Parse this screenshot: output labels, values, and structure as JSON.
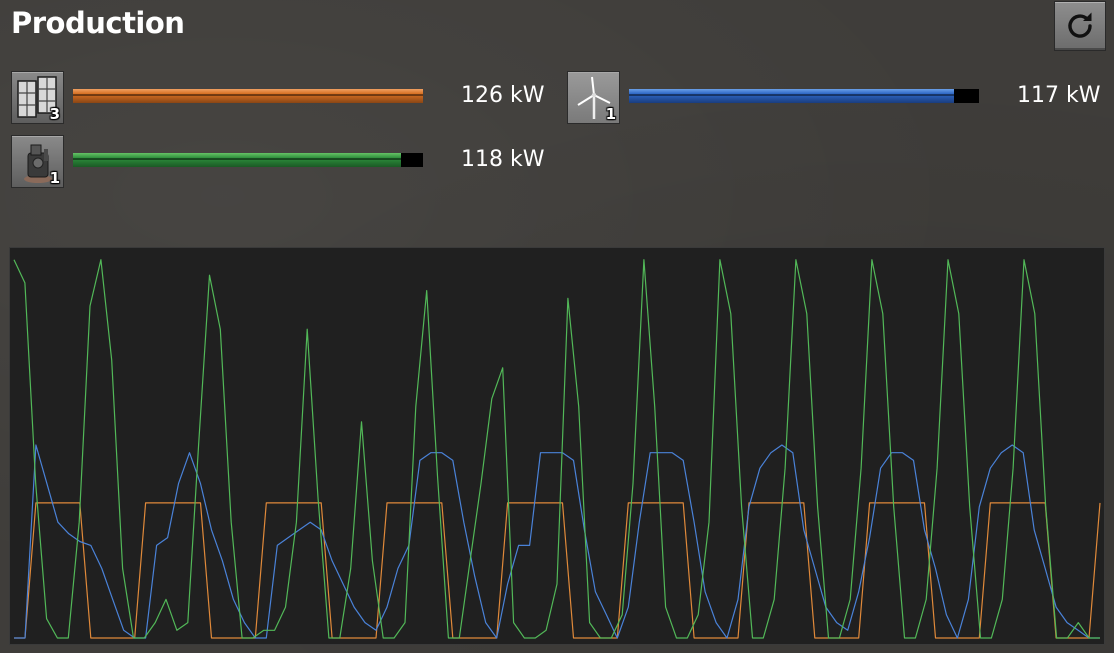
{
  "header": {
    "title": "Production"
  },
  "entries": [
    {
      "name": "solar-panel",
      "icon": "solar-panel-icon",
      "count": "3",
      "value_label": "126 kW",
      "fill": 1.0,
      "color": "#d66f22"
    },
    {
      "name": "wind-turbine",
      "icon": "wind-turbine-icon",
      "count": "1",
      "value_label": "117 kW",
      "fill": 0.928,
      "color": "#2d66c4"
    },
    {
      "name": "steam-engine",
      "icon": "steam-engine-icon",
      "count": "1",
      "value_label": "118 kW",
      "fill": 0.936,
      "color": "#2e8f3c"
    }
  ],
  "chart_data": {
    "type": "line",
    "title": "",
    "xlabel": "",
    "ylabel": "",
    "ylim": [
      0,
      100
    ],
    "grid": false,
    "series": [
      {
        "color": "#e0893a",
        "values": [
          0,
          0,
          35,
          35,
          35,
          35,
          35,
          0,
          0,
          0,
          0,
          0,
          35,
          35,
          35,
          35,
          35,
          35,
          0,
          0,
          0,
          0,
          0,
          35,
          35,
          35,
          35,
          35,
          35,
          0,
          0,
          0,
          0,
          0,
          35,
          35,
          35,
          35,
          35,
          35,
          0,
          0,
          0,
          0,
          0,
          35,
          35,
          35,
          35,
          35,
          35,
          0,
          0,
          0,
          0,
          0,
          35,
          35,
          35,
          35,
          35,
          35,
          0,
          0,
          0,
          0,
          0,
          35,
          35,
          35,
          35,
          35,
          35,
          0,
          0,
          0,
          0,
          0,
          35,
          35,
          35,
          35,
          35,
          35,
          0,
          0,
          0,
          0,
          0,
          35,
          35,
          35,
          35,
          35,
          35,
          0,
          0,
          0,
          0,
          35
        ]
      },
      {
        "color": "#4a82d8",
        "values": [
          0,
          0,
          50,
          40,
          30,
          27,
          25,
          24,
          18,
          10,
          2,
          0,
          0,
          24,
          26,
          40,
          48,
          40,
          28,
          20,
          10,
          4,
          0,
          0,
          24,
          26,
          28,
          30,
          28,
          20,
          14,
          8,
          4,
          2,
          8,
          18,
          24,
          46,
          48,
          48,
          46,
          30,
          16,
          4,
          0,
          14,
          24,
          24,
          48,
          48,
          48,
          46,
          28,
          12,
          6,
          0,
          8,
          30,
          48,
          48,
          48,
          46,
          30,
          12,
          4,
          0,
          10,
          34,
          44,
          48,
          50,
          48,
          28,
          18,
          8,
          4,
          2,
          12,
          26,
          44,
          48,
          48,
          46,
          28,
          18,
          6,
          0,
          10,
          34,
          44,
          48,
          50,
          48,
          28,
          18,
          8,
          4,
          2,
          0,
          0
        ]
      },
      {
        "color": "#52b858",
        "values": [
          98,
          92,
          40,
          5,
          0,
          0,
          30,
          86,
          98,
          72,
          18,
          0,
          0,
          4,
          10,
          2,
          4,
          50,
          94,
          80,
          30,
          0,
          0,
          2,
          2,
          8,
          30,
          80,
          36,
          0,
          0,
          18,
          56,
          20,
          0,
          0,
          4,
          60,
          90,
          42,
          0,
          0,
          20,
          40,
          62,
          70,
          4,
          0,
          0,
          2,
          14,
          88,
          60,
          4,
          0,
          0,
          6,
          40,
          98,
          60,
          8,
          0,
          0,
          6,
          30,
          98,
          84,
          34,
          0,
          0,
          10,
          44,
          98,
          84,
          34,
          0,
          0,
          10,
          44,
          98,
          84,
          34,
          0,
          0,
          10,
          44,
          98,
          84,
          34,
          0,
          0,
          10,
          44,
          98,
          84,
          34,
          0,
          0,
          4,
          0,
          0
        ]
      }
    ]
  }
}
